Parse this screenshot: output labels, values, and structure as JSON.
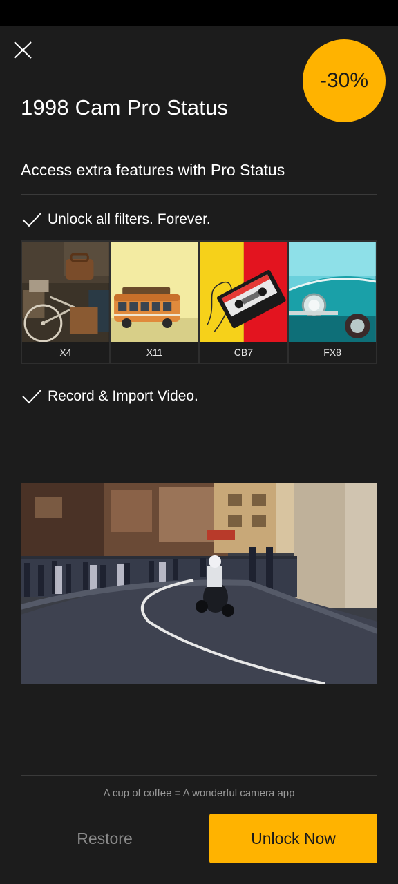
{
  "header": {
    "title": "1998 Cam Pro Status",
    "discount": "-30%",
    "subtitle": "Access extra features with Pro Status"
  },
  "features": [
    {
      "label": "Unlock all filters. Forever."
    },
    {
      "label": "Record & Import Video."
    }
  ],
  "filters": [
    {
      "name": "X4"
    },
    {
      "name": "X11"
    },
    {
      "name": "CB7"
    },
    {
      "name": "FX8"
    }
  ],
  "footer": {
    "tagline": "A cup of coffee = A wonderful camera app",
    "restore_label": "Restore",
    "unlock_label": "Unlock Now"
  },
  "colors": {
    "accent": "#ffb300",
    "background": "#1c1c1c"
  }
}
